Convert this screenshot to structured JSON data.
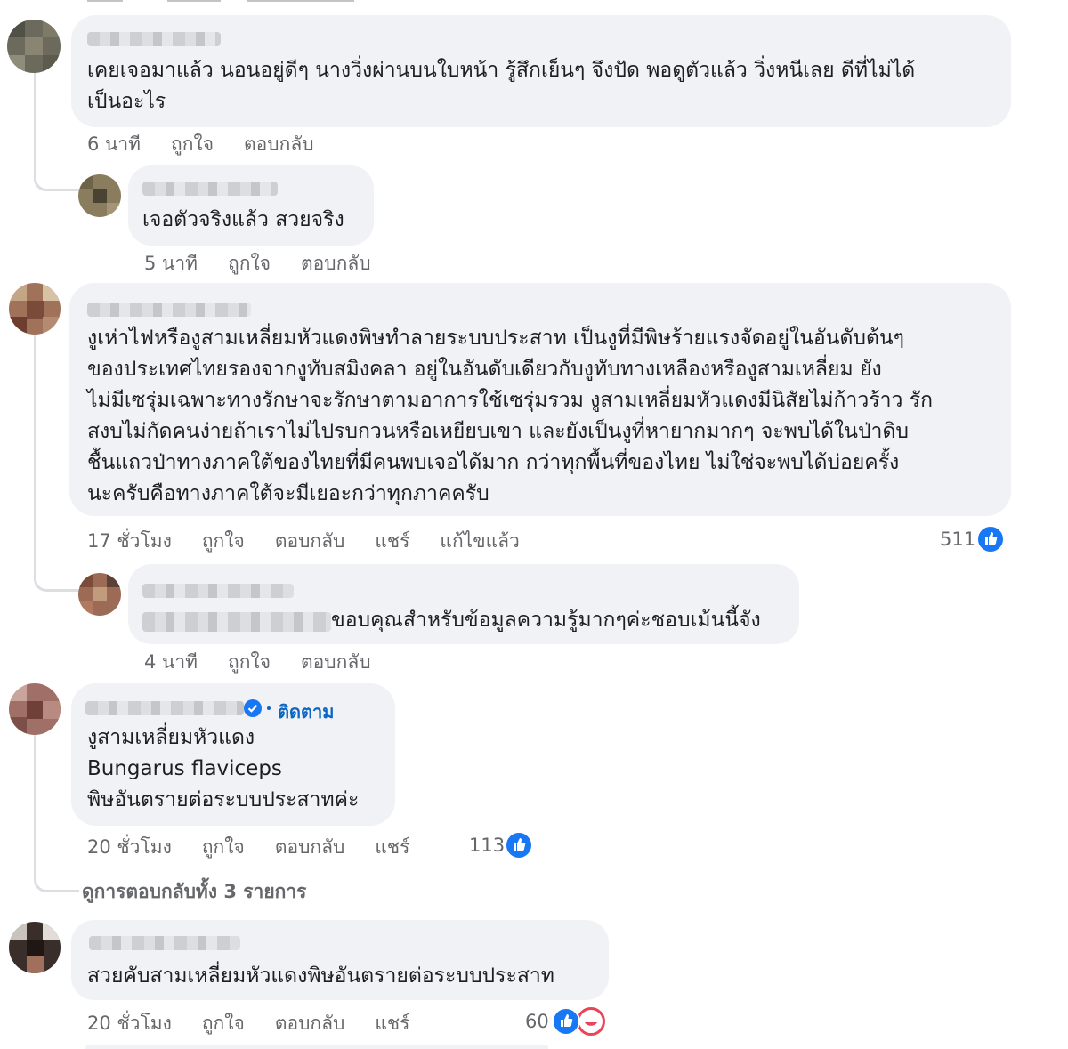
{
  "comments": [
    {
      "text_lines": [
        "เคยเจอมาแล้ว นอนอยู่ดีๆ นางวิ่งผ่านบนใบหน้า รู้สึกเย็นๆ จึงปัด พอดูตัวแล้ว วิ่งหนีเลย ดีที่ไม่ได้",
        "เป็นอะไร"
      ],
      "time": "6 นาที",
      "like": "ถูกใจ",
      "reply": "ตอบกลับ"
    },
    {
      "text_lines": [
        "เจอตัวจริงแล้ว สวยจริง"
      ],
      "time": "5 นาที",
      "like": "ถูกใจ",
      "reply": "ตอบกลับ"
    },
    {
      "text_lines": [
        "งูเห่าไฟหรืองูสามเหลี่ยมหัวแดงพิษทำลายระบบประสาท เป็นงูที่มีพิษร้ายแรงจัดอยู่ในอันดับต้นๆ",
        "ของประเทศไทยรองจากงูทับสมิงคลา อยู่ในอันดับเดียวกับงูทับทางเหลืองหรืองูสามเหลี่ยม ยัง",
        "ไม่มีเซรุ่มเฉพาะทางรักษาจะรักษาตามอาการใช้เซรุ่มรวม งูสามเหลี่ยมหัวแดงมีนิสัยไม่ก้าวร้าว รัก",
        "สงบไม่กัดคนง่ายถ้าเราไม่ไปรบกวนหรือเหยียบเขา และยังเป็นงูที่หายากมากๆ จะพบได้ในป่าดิบ",
        "ชื้นแถวป่าทางภาคใต้ของไทยที่มีคนพบเจอได้มาก กว่าทุกพื้นที่ของไทย ไม่ใช่จะพบได้บ่อยครั้ง",
        "นะครับคือทางภาคใต้จะมีเยอะกว่าทุกภาคครับ"
      ],
      "time": "17 ชั่วโมง",
      "like": "ถูกใจ",
      "reply": "ตอบกลับ",
      "share": "แชร์",
      "edited": "แก้ไขแล้ว",
      "reaction_count": "511"
    },
    {
      "text_lines": [
        "ขอบคุณสำหรับข้อมูลความรู้มากๆค่ะชอบเม้นนี้จัง"
      ],
      "time": "4 นาที",
      "like": "ถูกใจ",
      "reply": "ตอบกลับ"
    },
    {
      "follow": "ติดตาม",
      "text_lines": [
        "งูสามเหลี่ยมหัวแดง",
        "Bungarus flaviceps",
        "พิษอันตรายต่อระบบประสาทค่ะ"
      ],
      "time": "20 ชั่วโมง",
      "like": "ถูกใจ",
      "reply": "ตอบกลับ",
      "share": "แชร์",
      "reaction_count": "113"
    },
    {
      "text_lines": [
        "สวยคับสามเหลี่ยมหัวแดงพิษอันตรายต่อระบบประสาท"
      ],
      "time": "20 ชั่วโมง",
      "like": "ถูกใจ",
      "reply": "ตอบกลับ",
      "share": "แชร์",
      "reaction_count": "60"
    }
  ],
  "view_replies": "ดูการตอบกลับทั้ง 3 รายการ",
  "colors": {
    "like_blue": "#1877f2",
    "haha_red": "#e9445a",
    "bubble": "#f0f2f5",
    "meta_gray": "#65676b"
  }
}
